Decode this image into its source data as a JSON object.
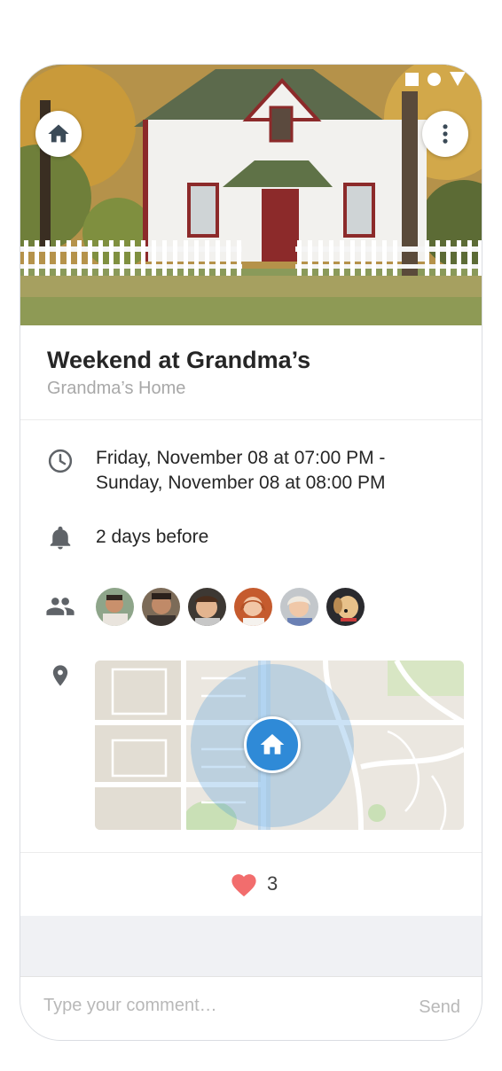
{
  "event": {
    "title": "Weekend at Grandma’s",
    "location": "Grandma’s Home",
    "time_line1": "Friday, November 08 at 07:00 PM -",
    "time_line2": "Sunday, November 08 at 08:00 PM",
    "reminder": "2 days before"
  },
  "icons": {
    "header_home": "home-icon",
    "header_more": "more-vertical-icon",
    "time": "clock-icon",
    "reminder": "bell-icon",
    "guests": "people-icon",
    "location": "pin-icon",
    "map_marker": "home-marker-icon",
    "like": "heart-icon"
  },
  "guests": [
    {
      "name": "guest-1"
    },
    {
      "name": "guest-2"
    },
    {
      "name": "guest-3"
    },
    {
      "name": "guest-4"
    },
    {
      "name": "guest-5"
    },
    {
      "name": "guest-6"
    }
  ],
  "likes": {
    "count": "3"
  },
  "comment": {
    "placeholder": "Type your comment…",
    "send_label": "Send"
  },
  "colors": {
    "accent": "#2f8ad7",
    "heart": "#f26d6d",
    "icon_gray": "#5f6368"
  }
}
